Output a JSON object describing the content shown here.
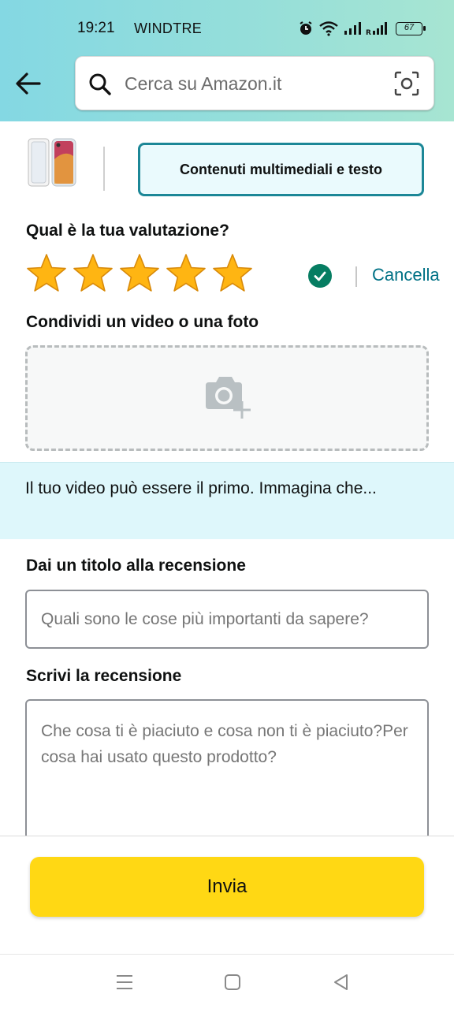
{
  "status_bar": {
    "time": "19:21",
    "carrier": "WINDTRE",
    "battery": "67",
    "icons": [
      "alarm-icon",
      "wifi-icon",
      "signal-icon",
      "roaming-signal-icon",
      "battery-icon"
    ]
  },
  "header": {
    "back_icon": "arrow-left-icon",
    "search_placeholder": "Cerca su Amazon.it",
    "search_icon": "search-icon",
    "lens_icon": "camera-scan-icon",
    "gradient_colors": [
      "#84d8e3",
      "#a7e5d2"
    ]
  },
  "product": {
    "tab_label": "Contenuti multimediali e testo"
  },
  "rating": {
    "label": "Qual è la tua valutazione?",
    "stars_filled": 5,
    "stars_total": 5,
    "cancel_label": "Cancella"
  },
  "media": {
    "label": "Condividi un video o una foto",
    "upload_icon": "camera-add-icon"
  },
  "info_banner": {
    "text": "Il tuo video può essere il primo. Immagina che..."
  },
  "review_title": {
    "label": "Dai un titolo alla recensione",
    "placeholder": "Quali sono le cose più importanti da sapere?",
    "value": ""
  },
  "review_body": {
    "label": "Scrivi la recensione",
    "placeholder": "Che cosa ti è piaciuto e cosa non ti è piaciuto?Per cosa hai usato questo prodotto?",
    "value": ""
  },
  "submit": {
    "label": "Invia",
    "color": "#ffd814"
  },
  "colors": {
    "accent_teal": "#1c8797",
    "link": "#007185",
    "success": "#067d62"
  },
  "nav_bar": {
    "items": [
      "menu-icon",
      "home-square-icon",
      "back-triangle-icon"
    ]
  }
}
